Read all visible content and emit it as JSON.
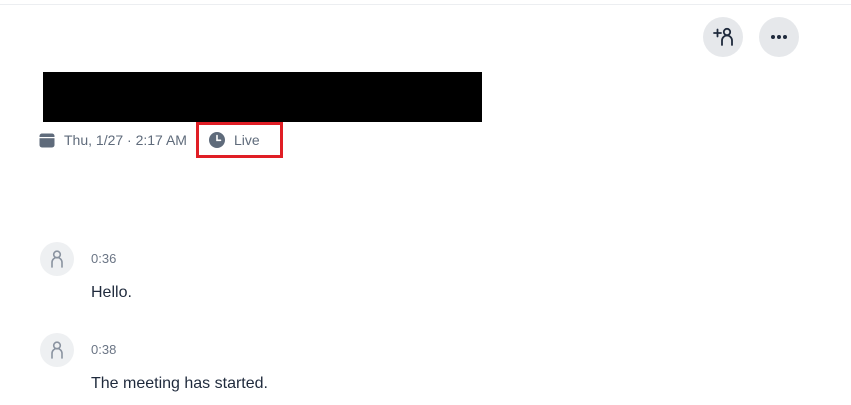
{
  "header": {
    "add_participant_icon": "add-person-icon",
    "more_icon": "ellipsis-icon"
  },
  "meeting": {
    "date_time": "Thu, 1/27 · 2:17 AM",
    "status": "Live",
    "highlight_color": "#e01e25"
  },
  "transcript": [
    {
      "time": "0:36",
      "text": "Hello."
    },
    {
      "time": "0:38",
      "text": "The meeting has started."
    }
  ]
}
